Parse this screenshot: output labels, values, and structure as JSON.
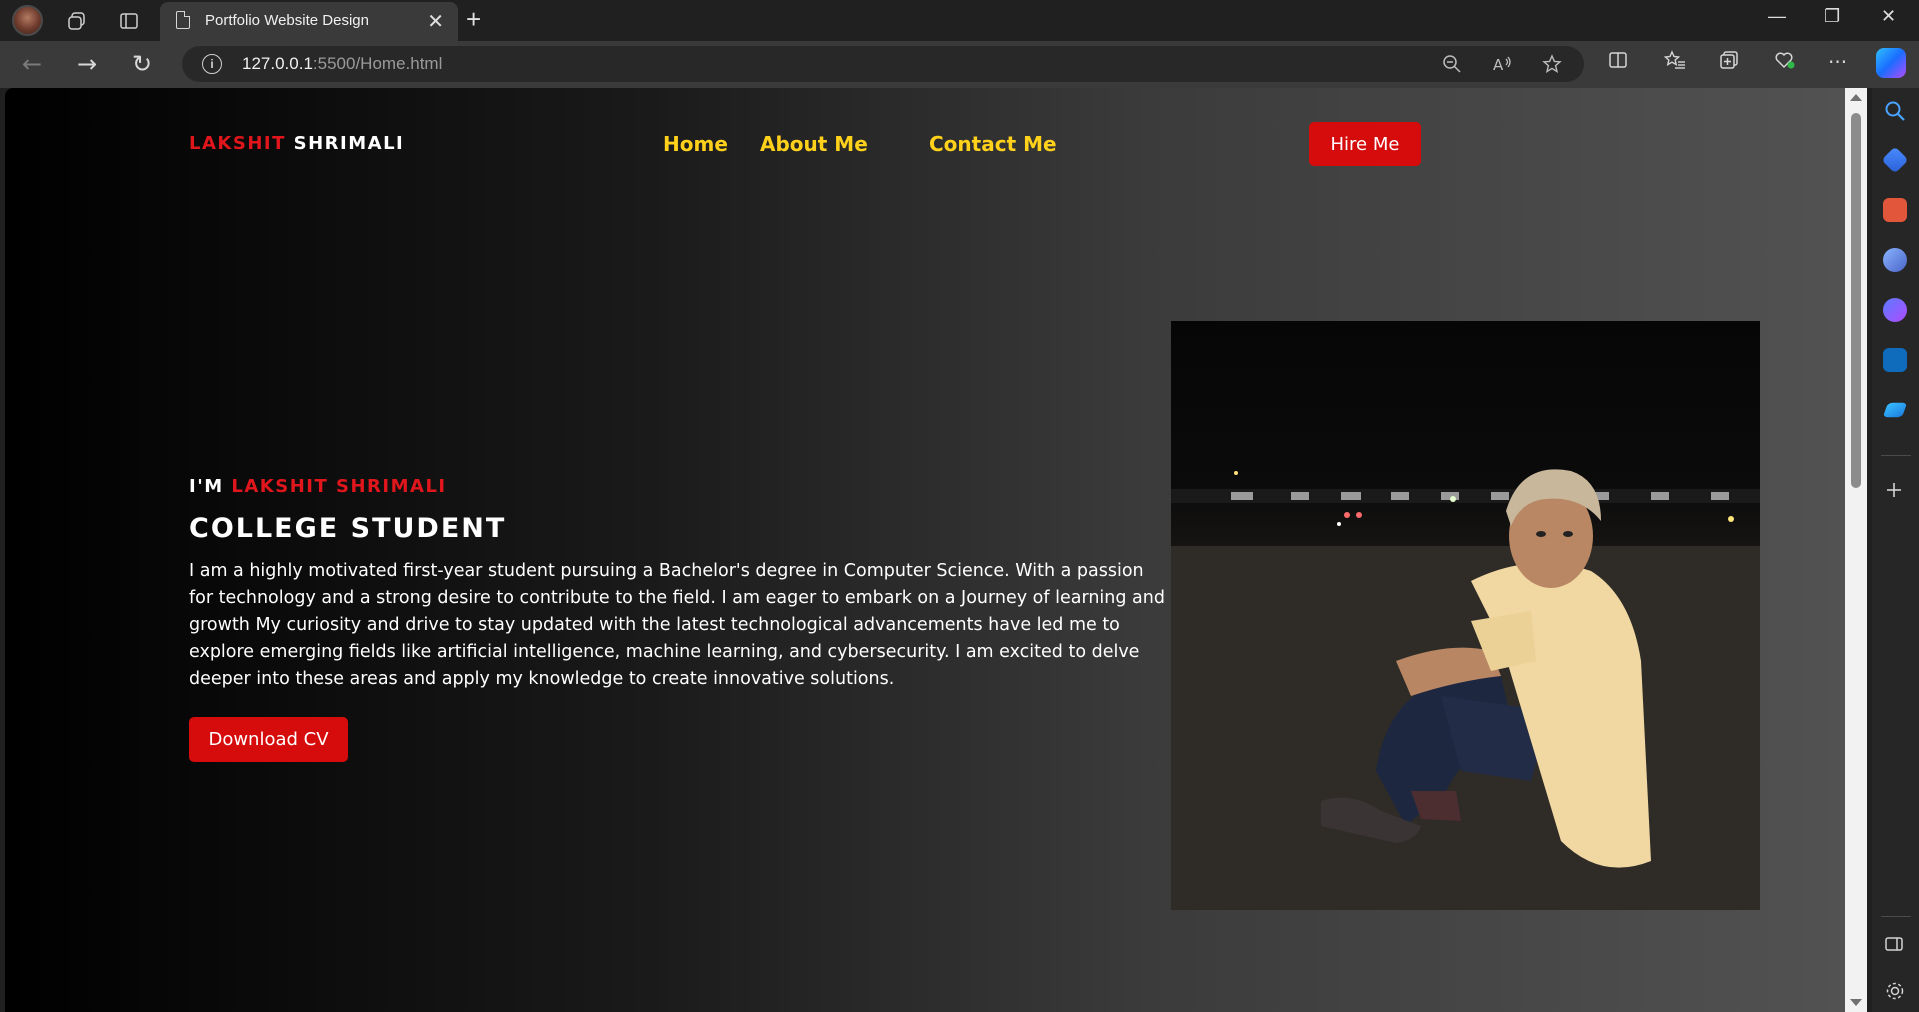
{
  "browser": {
    "tab_title": "Portfolio Website Design",
    "url_host": "127.0.0.1",
    "url_rest": ":5500/Home.html",
    "close_glyph": "✕",
    "newtab_glyph": "+",
    "minimize_glyph": "—",
    "restore_glyph": "❐",
    "window_close_glyph": "✕",
    "back_glyph": "←",
    "forward_glyph": "→",
    "refresh_glyph": "↻",
    "info_glyph": "i",
    "more_glyph": "···"
  },
  "page": {
    "logo_first": "LAKSHIT",
    "logo_last": "SHRIMALI",
    "nav": [
      "Home",
      "About Me",
      "Contact Me"
    ],
    "hire_label": "Hire Me",
    "intro_prefix": "I'M",
    "intro_name": "LAKSHIT SHRIMALI",
    "role": "COLLEGE STUDENT",
    "description": "I am a highly motivated first-year student pursuing a Bachelor's degree in Computer Science. With a passion for technology and a strong desire to contribute to the field. I am eager to embark on a Journey of learning and growth My curiosity and drive to stay updated with the latest technological advancements have led me to explore emerging fields like artificial intelligence, machine learning, and cybersecurity. I am excited to delve deeper into these areas and apply my knowledge to create innovative solutions.",
    "cv_label": "Download CV"
  },
  "colors": {
    "accent_red": "#d60b0b",
    "nav_yellow": "#ffd11a",
    "logo_red": "#e0161c"
  }
}
